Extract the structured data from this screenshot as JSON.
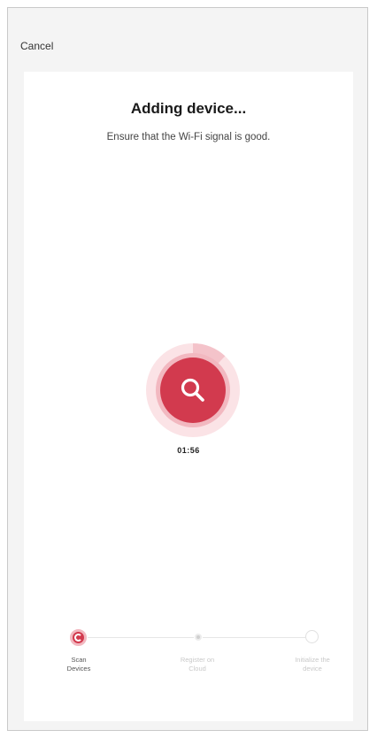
{
  "header": {
    "cancel_label": "Cancel"
  },
  "main": {
    "title": "Adding device...",
    "subtitle": "Ensure that the Wi-Fi signal is good.",
    "timer": "01:56",
    "scan_progress": 0.12
  },
  "steps": [
    {
      "line1": "Scan",
      "line2": "Devices",
      "state": "active"
    },
    {
      "line1": "Register on",
      "line2": "Cloud",
      "state": "pending"
    },
    {
      "line1": "Initialize the",
      "line2": "device",
      "state": "pending"
    }
  ],
  "colors": {
    "accent": "#d23a4e",
    "accent_light": "#f2b8c0",
    "accent_pale": "#fbe3e6",
    "inactive": "#c9c9c9"
  },
  "icons": {
    "scanner": "search-icon",
    "step_active": "loading-icon"
  }
}
